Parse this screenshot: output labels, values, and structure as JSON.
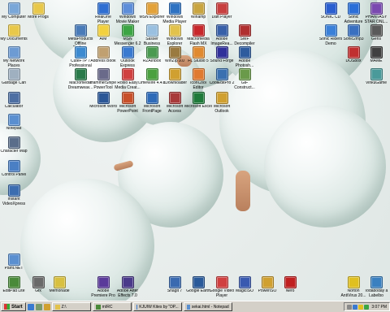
{
  "desktop": {
    "icons": [
      {
        "label": "My Computer",
        "color": "#7aa7d8"
      },
      {
        "label": "More Progs",
        "color": "#e8c84a"
      },
      {
        "label": "My Documents",
        "color": "#e8c84a"
      },
      {
        "label": "My Network Places",
        "color": "#6d9bd3"
      },
      {
        "label": "Garbage Can",
        "color": "#9fb0c0"
      },
      {
        "label": "Calculator",
        "color": "#4d6fa3"
      },
      {
        "label": "Notepad",
        "color": "#5a8fd0"
      },
      {
        "label": "Character Map",
        "color": "#5a6d8a"
      },
      {
        "label": "Control Panel",
        "color": "#4a7fc4"
      },
      {
        "label": "Instant VideoXpress",
        "color": "#3c6db0"
      },
      {
        "label": "RealOne Player",
        "color": "#2f6fd2"
      },
      {
        "label": "Windows Movie Maker",
        "color": "#5d8ed9"
      },
      {
        "label": "MSN Explorer",
        "color": "#e3a23a"
      },
      {
        "label": "Windows Media Player",
        "color": "#2f72c2"
      },
      {
        "label": "Winamp",
        "color": "#c9a540"
      },
      {
        "label": "Daft Player",
        "color": "#c84040"
      },
      {
        "label": "MetaProducts Offline Explorer",
        "color": "#497bb8"
      },
      {
        "label": "AIM",
        "color": "#f2d13e"
      },
      {
        "label": "MSN Messenger 6.2",
        "color": "#3ca544"
      },
      {
        "label": "Sasser Business",
        "color": "#9ac0e0"
      },
      {
        "label": "Windows Explorer",
        "color": "#e2c24c"
      },
      {
        "label": "Macromedia Flash MX",
        "color": "#c8282c"
      },
      {
        "label": "Adobe ImageRea...",
        "color": "#3860a8"
      },
      {
        "label": "SWF Decompiler",
        "color": "#b03030"
      },
      {
        "label": "CuteFTP 7 Professional",
        "color": "#3d8ad0"
      },
      {
        "label": "Address Book",
        "color": "#c0a070"
      },
      {
        "label": "Outlook Express",
        "color": "#3a7ad0"
      },
      {
        "label": "RZAInbox",
        "color": "#4a9a50"
      },
      {
        "label": "WinZip 9.0",
        "color": "#9a7a40"
      },
      {
        "label": "FL Studio 5",
        "color": "#e08a30"
      },
      {
        "label": "Sound Forge",
        "color": "#30309a"
      },
      {
        "label": "Adobe Photosh...",
        "color": "#2e5c9e"
      },
      {
        "label": "Macromedia Dreamweav...",
        "color": "#2a7a4a"
      },
      {
        "label": "HammerSnipe PowerTool",
        "color": "#6a6a8a"
      },
      {
        "label": "Roxio Easy Media Creat...",
        "color": "#d04040"
      },
      {
        "label": "LimeWire 4.4.1",
        "color": "#4aa040"
      },
      {
        "label": "YDownloader",
        "color": "#d0a030"
      },
      {
        "label": "IconCool Editor",
        "color": "#e07a30"
      },
      {
        "label": "CoolEditPro 2",
        "color": "#3a70b0"
      },
      {
        "label": "GIF Construct...",
        "color": "#6a9a4a"
      },
      {
        "label": "Microsoft Word",
        "color": "#2b5797"
      },
      {
        "label": "Microsoft PowerPoint",
        "color": "#c8502a"
      },
      {
        "label": "Microsoft FrontPage",
        "color": "#2f6bb8"
      },
      {
        "label": "Microsoft Access",
        "color": "#a83a3a"
      },
      {
        "label": "Microsoft Excel",
        "color": "#1f7a3a"
      },
      {
        "label": "Microsoft Outlook",
        "color": "#d0a030"
      },
      {
        "label": "SONIC CD",
        "color": "#2a5fd0"
      },
      {
        "label": "Sonic Adventure",
        "color": "#2a6fd8"
      },
      {
        "label": "PHANTASY STAR ONL...",
        "color": "#7a4ab0"
      },
      {
        "label": "Sonic Riders Demo",
        "color": "#3a80d8"
      },
      {
        "label": "Sonic2mp3",
        "color": "#3a70c0"
      },
      {
        "label": "Gens",
        "color": "#5a5a5a"
      },
      {
        "label": "DOSbox",
        "color": "#c03030"
      },
      {
        "label": "MAME",
        "color": "#404040"
      },
      {
        "label": "VinkuGame",
        "color": "#4a9a9a"
      },
      {
        "label": "Paint.NET",
        "color": "#5a8fd0"
      },
      {
        "label": "EditPad Lite",
        "color": "#4a8a3a"
      },
      {
        "label": "Gfx",
        "color": "#6a6a6a"
      },
      {
        "label": "Memonade",
        "color": "#d8c040"
      },
      {
        "label": "Adobe Premiere Pro",
        "color": "#5a3a9a"
      },
      {
        "label": "Adobe After Effects 7.0",
        "color": "#4a3a8a"
      },
      {
        "label": "Snagit 7",
        "color": "#3a6ab0"
      },
      {
        "label": "Google Earth",
        "color": "#2a5a9a"
      },
      {
        "label": "Google Video Player",
        "color": "#d04040"
      },
      {
        "label": "MagicISO",
        "color": "#3a5ab0"
      },
      {
        "label": "PowerISO",
        "color": "#d0a030"
      },
      {
        "label": "Nero",
        "color": "#c02020"
      },
      {
        "label": "Norton AntiVirus 20...",
        "color": "#e0c020"
      },
      {
        "label": "Todaboday a Labelbo",
        "color": "#3a80c0"
      }
    ]
  },
  "taskbar": {
    "start_label": "Start",
    "tasks": [
      {
        "label": "Z:\\"
      },
      {
        "label": "mIRC"
      },
      {
        "label": "KJUIW Kites by \"DP..."
      },
      {
        "label": "sekai.html - Notepad"
      }
    ],
    "clock": "3:07 PM"
  }
}
